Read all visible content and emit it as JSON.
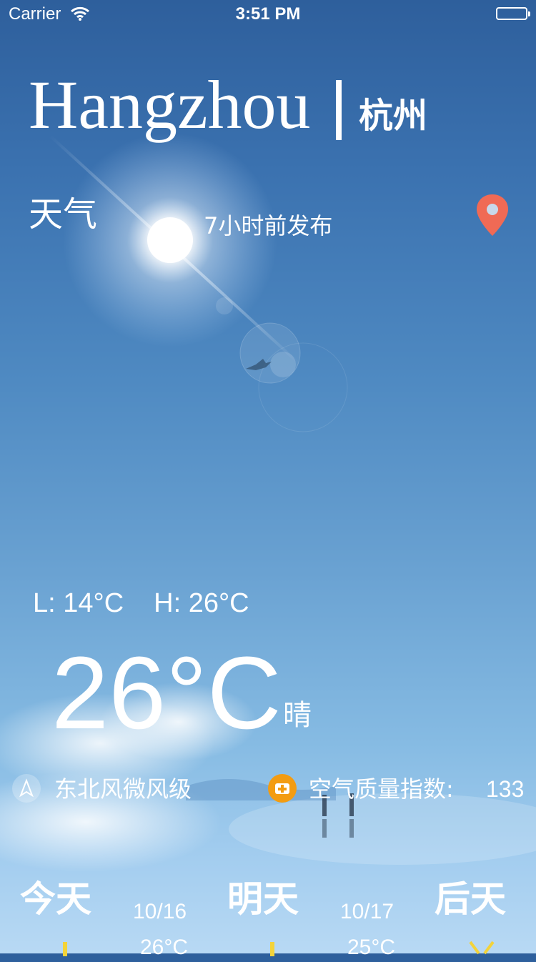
{
  "status_bar": {
    "carrier": "Carrier",
    "time": "3:51 PM"
  },
  "header": {
    "city_en": "Hangzhou",
    "city_cn": "杭州",
    "weather_label": "天气",
    "publish_time": "7小时前发布"
  },
  "current": {
    "low": "L: 14°C",
    "high": "H: 26°C",
    "temperature": "26°C",
    "condition": "晴",
    "wind": "东北风微风级",
    "aqi_label": "空气质量指数:",
    "aqi_value": "133"
  },
  "forecast": [
    {
      "label": "今天",
      "date": "10/16",
      "temp": "26°C"
    },
    {
      "label": "明天",
      "date": "10/17",
      "temp": "25°C"
    },
    {
      "label": "后天"
    }
  ],
  "icons": {
    "location": "map-pin-icon",
    "wind": "wind-direction-icon",
    "aqi": "air-quality-icon",
    "wifi": "wifi-icon",
    "battery": "battery-icon"
  },
  "colors": {
    "pin": "#f06a55",
    "aqi_badge": "#f39c12",
    "forecast_mark": "#f3d33a"
  }
}
